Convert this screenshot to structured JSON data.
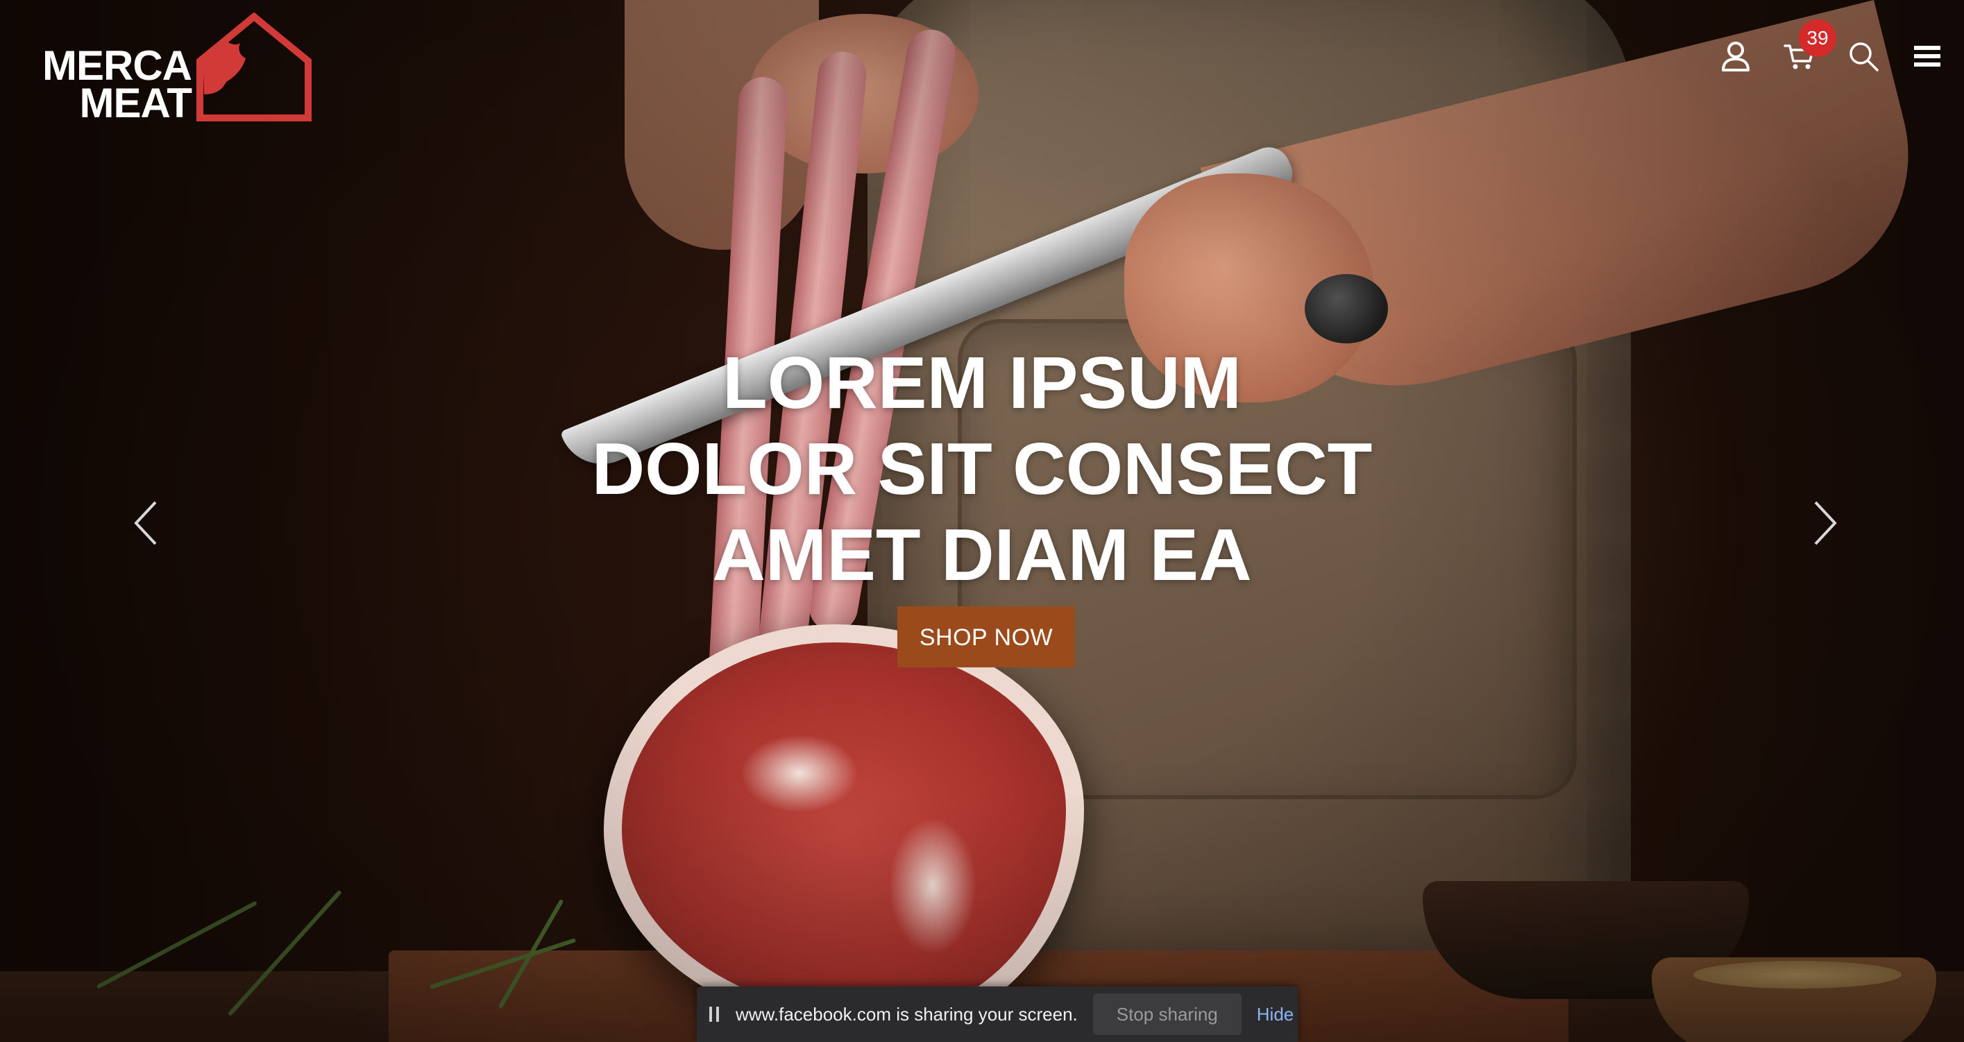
{
  "brand": {
    "line1": "MERCA",
    "line2": "MEAT",
    "accent_color": "#d13a37"
  },
  "header": {
    "icons": [
      "user-icon",
      "cart-icon",
      "search-icon",
      "menu-icon"
    ],
    "cart_count": "39",
    "badge_color": "#d42a2a"
  },
  "hero": {
    "title_line1": "LOREM IPSUM",
    "title_line2": "DOLOR SIT CONSECT",
    "title_line3": "AMET DIAM EA",
    "cta_label": "SHOP NOW",
    "cta_color": "#9b4a1c",
    "prev_icon": "chevron-left-icon",
    "next_icon": "chevron-right-icon"
  },
  "share_bar": {
    "message": "www.facebook.com is sharing your screen.",
    "stop_label": "Stop sharing",
    "hide_label": "Hide",
    "link_color": "#8ab4f8"
  }
}
